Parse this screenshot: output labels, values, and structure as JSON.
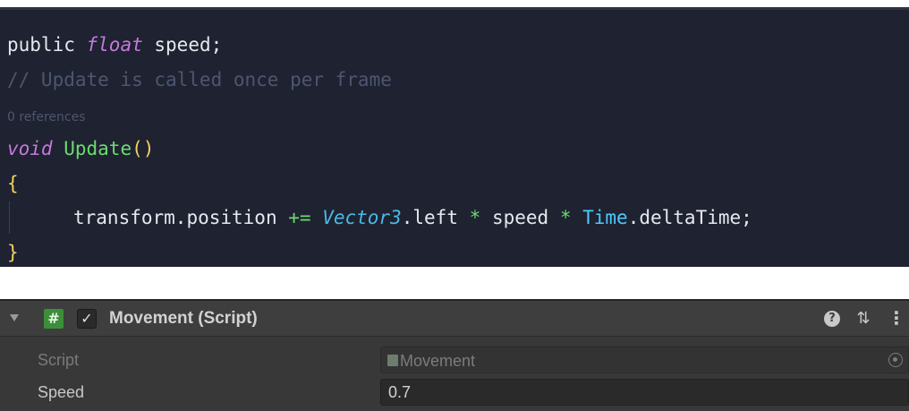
{
  "code": {
    "line1": {
      "keyword": "public",
      "type": "float",
      "identifier": "speed;"
    },
    "line2": {
      "comment": "// Update is called once per frame"
    },
    "line3": {
      "codelens": "0 references"
    },
    "line4": {
      "keyword": "void",
      "method": "Update",
      "parens": "()"
    },
    "line5": {
      "brace": "{"
    },
    "line6": {
      "object": "transform",
      "dot1": ".",
      "member1": "position",
      "operator": "+=",
      "type": "Vector3",
      "dot2": ".",
      "member2": "left",
      "mul1": "*",
      "ident1": "speed",
      "mul2": "*",
      "class": "Time",
      "dot3": ".",
      "member3": "deltaTime",
      "semicolon": ";"
    },
    "line7": {
      "brace": "}"
    }
  },
  "inspector": {
    "component_title": "Movement (Script)",
    "script_icon_glyph": "#",
    "checkbox_glyph": "✓",
    "help_glyph": "?",
    "presets_glyph": "⇅",
    "menu_glyph": "⋮",
    "script_label": "Script",
    "script_value": "Movement",
    "speed_label": "Speed",
    "speed_value": "0.7"
  },
  "colors": {
    "editor_bg": "#1f2230",
    "inspector_bg": "#383838",
    "keyword_italic": "#c678dd",
    "method": "#6cdb71",
    "type": "#4bb8e6",
    "brace": "#f1d35e"
  }
}
